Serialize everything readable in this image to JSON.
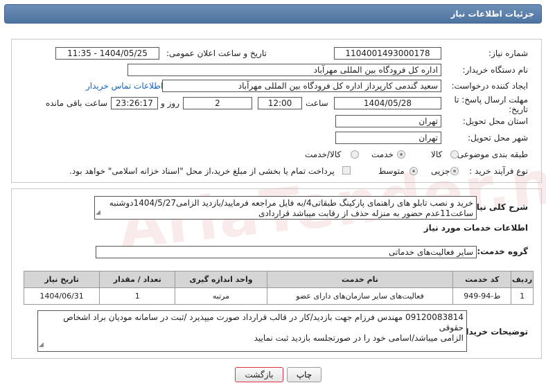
{
  "header": {
    "title": "جزئیات اطلاعات نیاز"
  },
  "need_number": {
    "label": "شماره نیاز:",
    "value": "1104001493000178"
  },
  "announce": {
    "label": "تاریخ و ساعت اعلان عمومی:",
    "value": "1404/05/25 - 11:35"
  },
  "buyer_org": {
    "label": "نام دستگاه خریدار:",
    "value": "اداره کل فرودگاه بین المللی مهرآباد"
  },
  "requester": {
    "label": "ایجاد کننده درخواست:",
    "value": "سعید گندمی کارپرداز اداره کل فرودگاه بین المللی مهرآباد",
    "contact_link": "اطلاعات تماس خریدار"
  },
  "deadline": {
    "label_line1": "مهلت ارسال پاسخ: تا",
    "label_line2": "تاریخ:",
    "date": "1404/05/28",
    "time_label": "ساعت",
    "time": "12:00",
    "days": "2",
    "days_label": "روز و",
    "remaining": "23:26:17",
    "remaining_label": "ساعت باقی مانده"
  },
  "province": {
    "label": "استان محل تحویل:",
    "value": "تهران"
  },
  "city": {
    "label": "شهر محل تحویل:",
    "value": "تهران"
  },
  "category": {
    "label": "طبقه بندی موضوعی:",
    "options": [
      "کالا",
      "خدمت",
      "کالا/خدمت"
    ],
    "selected": "خدمت"
  },
  "process": {
    "label": "نوع فرآیند خرید :",
    "options": [
      "جزیی",
      "متوسط"
    ],
    "selected": "جزیی",
    "payment_note": "پرداخت تمام یا بخشی از مبلغ خرید،از محل \"اسناد خزانه اسلامی\" خواهد بود."
  },
  "summary": {
    "label": "شرح کلی نیاز:",
    "line1": "خرید و نصب تابلو های راهنمای پارکینگ طبقاتی4/به فایل مراجعه فرمایید/بازدید الزامی1404/5/27دوشنبه",
    "line2": "ساعت11عدم حضور به منزله حذف از رقابت میباشد قراردادی"
  },
  "services_section": {
    "title": "اطلاعات خدمات مورد نیاز"
  },
  "service_group": {
    "label": "گروه خدمت:",
    "value": "سایر فعالیت‌های خدماتی"
  },
  "table": {
    "headers": [
      "ردیف",
      "کد خدمت",
      "نام خدمت",
      "واحد اندازه گیری",
      "تعداد / مقدار",
      "تاریخ نیاز"
    ],
    "rows": [
      [
        "1",
        "ط-94-949",
        "فعالیت‌های سایر سازمان‌های دارای عضو",
        "مرتبه",
        "1",
        "1404/06/31"
      ]
    ]
  },
  "buyer_notes": {
    "label": "توضیحات خریدار:",
    "line1": "09120083814 مهندس فرزام جهت بازدید/کار در قالب قرارداد صورت میپذیرد /ثبت در سامانه مودیان براد اشخاص حقوقی",
    "line2": "الزامی میباشد/اسامی خود را در صورتجلسه بازدید ثبت نمایید"
  },
  "buttons": {
    "print": "چاپ",
    "back": "بازگشت"
  },
  "watermark": "AriaTender.neT"
}
